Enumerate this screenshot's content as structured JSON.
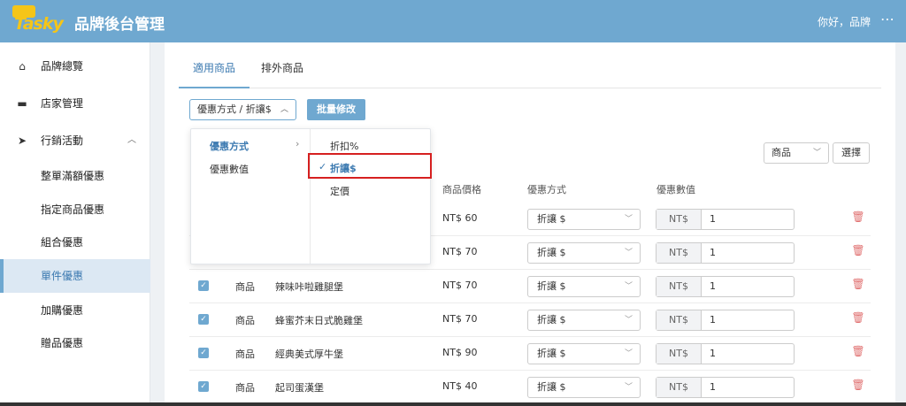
{
  "header": {
    "logo_text": "Tasky",
    "title": "品牌後台管理",
    "greeting": "你好，品牌",
    "more_icon": "⋯"
  },
  "sidebar": {
    "items": [
      {
        "label": "品牌總覽",
        "icon": "home-icon"
      },
      {
        "label": "店家管理",
        "icon": "store-icon"
      },
      {
        "label": "行銷活動",
        "icon": "send-icon"
      },
      {
        "label": "整單滿額優惠"
      },
      {
        "label": "指定商品優惠"
      },
      {
        "label": "組合優惠"
      },
      {
        "label": "單件優惠"
      },
      {
        "label": "加購優惠"
      },
      {
        "label": "贈品優惠"
      }
    ],
    "active": "單件優惠"
  },
  "tabs": [
    {
      "label": "適用商品"
    },
    {
      "label": "排外商品"
    }
  ],
  "toolbar": {
    "selector_value": "優惠方式 / 折讓$",
    "batch_button": "批量修改",
    "filter_value": "商品",
    "choose_button": "選擇"
  },
  "table": {
    "headers": [
      "商品價格",
      "優惠方式",
      "優惠數值"
    ],
    "rows": [
      {
        "type": "",
        "name": "",
        "price": "NT$ 60",
        "method": "折讓 $",
        "prefix": "NT$",
        "value": "1"
      },
      {
        "type": "",
        "name": "",
        "price": "NT$ 70",
        "method": "折讓 $",
        "prefix": "NT$",
        "value": "1"
      },
      {
        "type": "商品",
        "name": "辣味咔啦雞腿堡",
        "price": "NT$ 70",
        "method": "折讓 $",
        "prefix": "NT$",
        "value": "1"
      },
      {
        "type": "商品",
        "name": "蜂蜜芥末日式脆雞堡",
        "price": "NT$ 70",
        "method": "折讓 $",
        "prefix": "NT$",
        "value": "1"
      },
      {
        "type": "商品",
        "name": "經典美式厚牛堡",
        "price": "NT$ 90",
        "method": "折讓 $",
        "prefix": "NT$",
        "value": "1"
      },
      {
        "type": "商品",
        "name": "起司蛋漢堡",
        "price": "NT$ 40",
        "method": "折讓 $",
        "prefix": "NT$",
        "value": "1"
      }
    ]
  },
  "cascader": {
    "col1": [
      "優惠方式",
      "優惠數值"
    ],
    "col2": [
      "折扣%",
      "折讓$",
      "定價"
    ],
    "selected": "折讓$"
  },
  "colors": {
    "primary": "#6fa8d0",
    "highlight": "#d62020"
  }
}
